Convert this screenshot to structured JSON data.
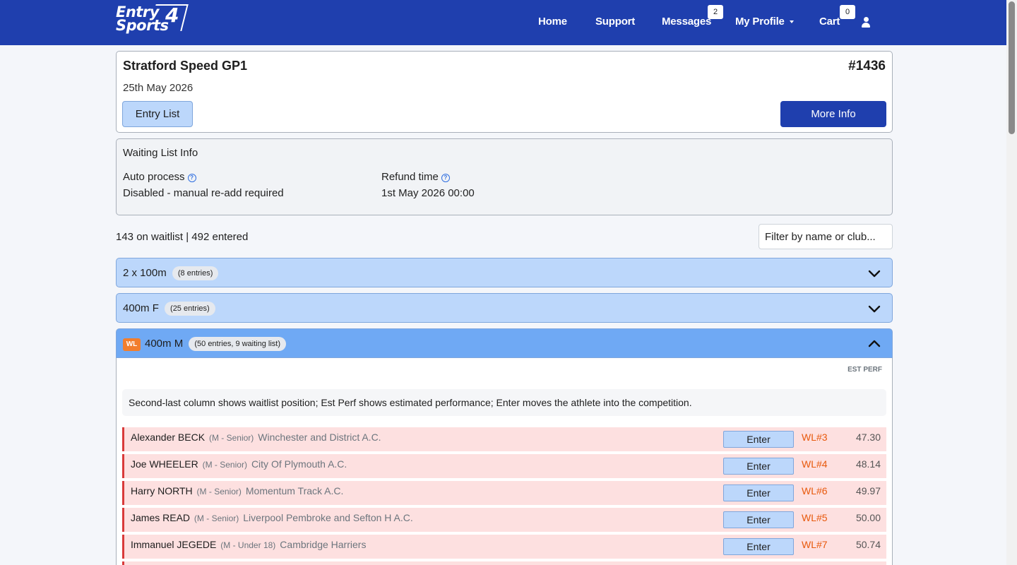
{
  "nav": {
    "logo_line1": "Entry",
    "logo_line2": "Sports",
    "logo_number": "4",
    "home": "Home",
    "support": "Support",
    "messages": "Messages",
    "messages_badge": "2",
    "profile": "My Profile",
    "cart": "Cart",
    "cart_badge": "0"
  },
  "competition": {
    "title": "Stratford Speed GP1",
    "id": "#1436",
    "date": "25th May 2026",
    "entry_list_label": "Entry List",
    "more_info_label": "More Info"
  },
  "waiting_list_info": {
    "heading": "Waiting List Info",
    "auto_process_label": "Auto process",
    "auto_process_value": "Disabled - manual re-add required",
    "refund_label": "Refund time",
    "refund_value": "1st May 2026 00:00"
  },
  "summary": {
    "counts": "143 on waitlist | 492 entered",
    "filter_placeholder": "Filter by name or club..."
  },
  "events": [
    {
      "title": "2 x 100m",
      "pill": "(8 entries)"
    },
    {
      "title": "400m F",
      "pill": "(25 entries)"
    },
    {
      "tag": "WL",
      "title": "400m M",
      "pill": "(50 entries, 9 waiting list)"
    }
  ],
  "open_event": {
    "est_perf_header": "EST PERF",
    "help_text": "Second-last column shows waitlist position; Est Perf shows estimated performance; Enter moves the athlete into the competition.",
    "enter_label": "Enter",
    "rows": [
      {
        "name": "Alexander BECK",
        "category": "(M - Senior)",
        "club": "Winchester and District A.C.",
        "wl": "WL#3",
        "perf": "47.30"
      },
      {
        "name": "Joe WHEELER",
        "category": "(M - Senior)",
        "club": "City Of Plymouth A.C.",
        "wl": "WL#4",
        "perf": "48.14"
      },
      {
        "name": "Harry NORTH",
        "category": "(M - Senior)",
        "club": "Momentum Track A.C.",
        "wl": "WL#6",
        "perf": "49.97"
      },
      {
        "name": "James READ",
        "category": "(M - Senior)",
        "club": "Liverpool Pembroke and Sefton H A.C.",
        "wl": "WL#5",
        "perf": "50.00"
      },
      {
        "name": "Immanuel JEGEDE",
        "category": "(M - Under 18)",
        "club": "Cambridge Harriers",
        "wl": "WL#7",
        "perf": "50.74"
      }
    ]
  }
}
